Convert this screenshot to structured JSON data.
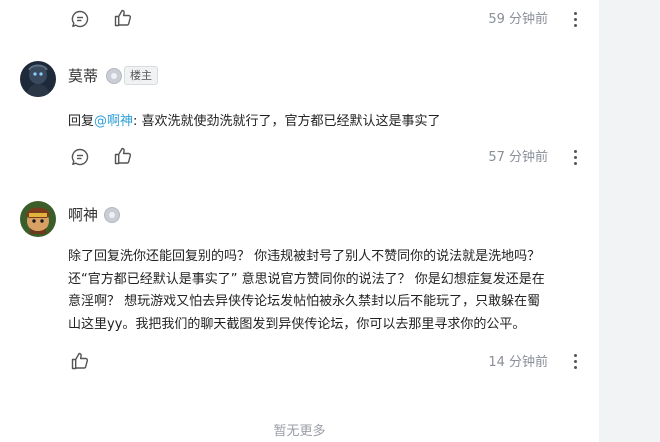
{
  "comments": [
    {
      "time": "59 分钟前"
    },
    {
      "username": "莫蒂",
      "badge": "楼主",
      "reply_prefix": "回复",
      "mention": "@啊神",
      "text": ": 喜欢洗就使劲洗就行了，官方都已经默认这是事实了",
      "time": "57 分钟前"
    },
    {
      "username": "啊神",
      "lines": [
        "除了回复洗你还能回复别的吗？ 你违规被封号了别人不赞同你的说法就是洗地吗？",
        "还“官方都已经默认是事实了” 意思说官方赞同你的说法了？ 你是幻想症复发还是在",
        "意淫啊？ 想玩游戏又怕去异侠传论坛发帖怕被永久禁封以后不能玩了，只敢躲在蜀",
        "山这里yy。我把我们的聊天截图发到异侠传论坛，你可以去那里寻求你的公平。"
      ],
      "time": "14 分钟前"
    }
  ],
  "footer": "暂无更多",
  "icons": [
    "reply-icon",
    "like-icon",
    "more-icon",
    "level-icon"
  ]
}
